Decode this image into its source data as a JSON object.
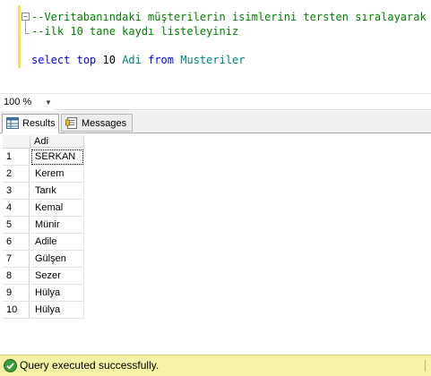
{
  "editor": {
    "lines": [
      {
        "type": "comment",
        "text": "--Veritabanındaki müşterilerin isimlerini tersten sıralayarak"
      },
      {
        "type": "comment",
        "text": "--ilk 10 tane kaydı listeleyiniz"
      },
      {
        "type": "sql",
        "tokens": [
          {
            "kind": "kw",
            "text": "select"
          },
          {
            "kind": "plain",
            "text": " "
          },
          {
            "kind": "kw",
            "text": "top"
          },
          {
            "kind": "plain",
            "text": " 10 "
          },
          {
            "kind": "ident",
            "text": "Adi"
          },
          {
            "kind": "plain",
            "text": " "
          },
          {
            "kind": "kw",
            "text": "from"
          },
          {
            "kind": "plain",
            "text": " "
          },
          {
            "kind": "ident",
            "text": "Musteriler"
          }
        ]
      }
    ],
    "fold_glyph": "−"
  },
  "zoom": {
    "value": "100 %",
    "arrow": "▼"
  },
  "tabs": [
    {
      "label": "Results",
      "icon": "grid-icon",
      "active": true
    },
    {
      "label": "Messages",
      "icon": "messages-icon",
      "active": false
    }
  ],
  "grid": {
    "column": "Adi",
    "rows": [
      {
        "num": "1",
        "value": "SERKAN"
      },
      {
        "num": "2",
        "value": "Kerem"
      },
      {
        "num": "3",
        "value": "Tarık"
      },
      {
        "num": "4",
        "value": "Kemal"
      },
      {
        "num": "5",
        "value": "Münir"
      },
      {
        "num": "6",
        "value": "Adile"
      },
      {
        "num": "7",
        "value": "Gülşen"
      },
      {
        "num": "8",
        "value": "Sezer"
      },
      {
        "num": "9",
        "value": "Hülya"
      },
      {
        "num": "10",
        "value": "Hülya"
      }
    ]
  },
  "status": {
    "text": "Query executed successfully.",
    "icon": "success-check-icon",
    "color": "#f7f3a6"
  }
}
